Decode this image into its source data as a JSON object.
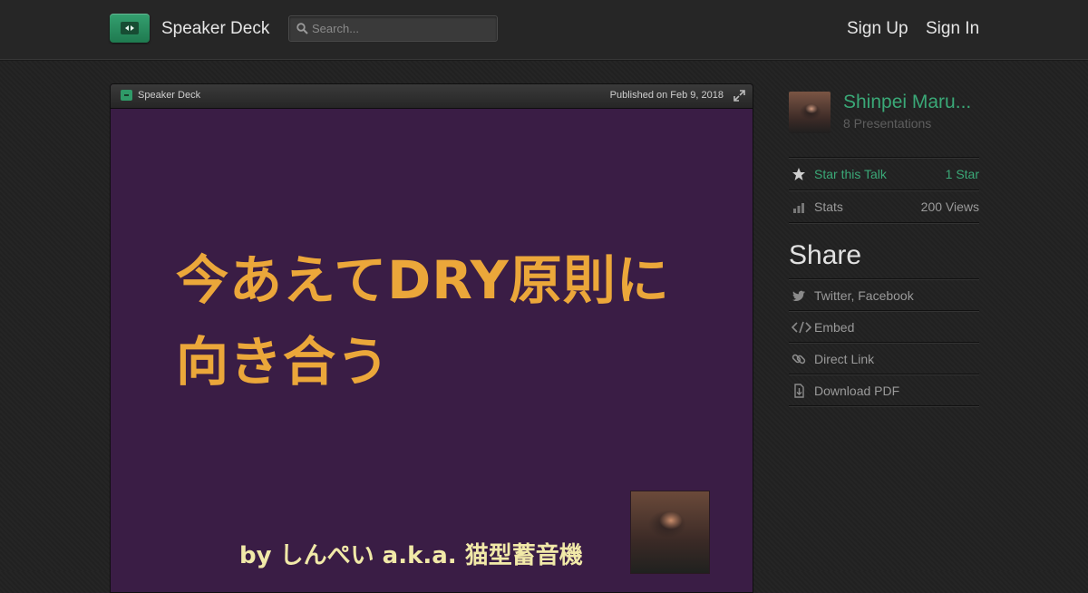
{
  "header": {
    "brand": "Speaker Deck",
    "search_placeholder": "Search...",
    "sign_up": "Sign Up",
    "sign_in": "Sign In"
  },
  "player": {
    "brand": "Speaker Deck",
    "published": "Published on Feb 9, 2018",
    "slide": {
      "title_line1": "今あえてDRY原則に",
      "title_line2": "向き合う",
      "author_line": "by しんぺい a.k.a. 猫型蓄音機",
      "background": "#3a1d45",
      "title_color": "#eba73a"
    }
  },
  "sidebar": {
    "author_name": "Shinpei Maru...",
    "presentations": "8 Presentations",
    "star_label": "Star this Talk",
    "star_count": "1 Star",
    "stats_label": "Stats",
    "views": "200 Views",
    "share_heading": "Share",
    "share_items": [
      {
        "label": "Twitter, Facebook",
        "icon": "twitter-icon"
      },
      {
        "label": "Embed",
        "icon": "code-icon"
      },
      {
        "label": "Direct Link",
        "icon": "link-icon"
      },
      {
        "label": "Download PDF",
        "icon": "download-icon"
      }
    ]
  },
  "colors": {
    "accent": "#3aa877",
    "background": "#222222"
  }
}
